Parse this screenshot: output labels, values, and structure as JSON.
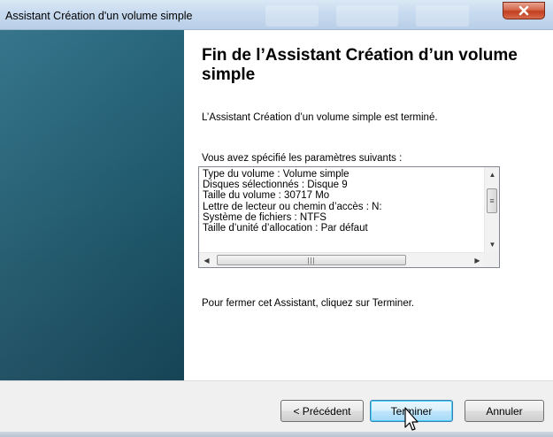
{
  "window": {
    "title": "Assistant Création d'un volume simple"
  },
  "main": {
    "heading": "Fin de l’Assistant Création d’un volume simple",
    "intro": "L’Assistant Création d’un volume simple est terminé.",
    "params_label": "Vous avez spécifié les paramètres suivants :",
    "params": [
      "Type du volume : Volume simple",
      "Disques sélectionnés : Disque 9",
      "Taille du volume : 30717 Mo",
      "Lettre de lecteur ou chemin d’accès : N:",
      "Système de fichiers : NTFS",
      "Taille d’unité d’allocation : Par défaut"
    ],
    "closing": "Pour fermer cet Assistant, cliquez sur Terminer."
  },
  "footer": {
    "back_label": "< Précédent",
    "finish_label": "Terminer",
    "cancel_label": "Annuler"
  },
  "icons": {
    "close": "close-icon",
    "scroll_up": "chevron-up-icon",
    "scroll_down": "chevron-down-icon",
    "scroll_left": "chevron-left-icon",
    "scroll_right": "chevron-right-icon",
    "cursor": "mouse-pointer-icon"
  },
  "colors": {
    "banner": "#236278",
    "primary_button_border": "#3c7fb1",
    "close_button": "#c23f1f"
  }
}
